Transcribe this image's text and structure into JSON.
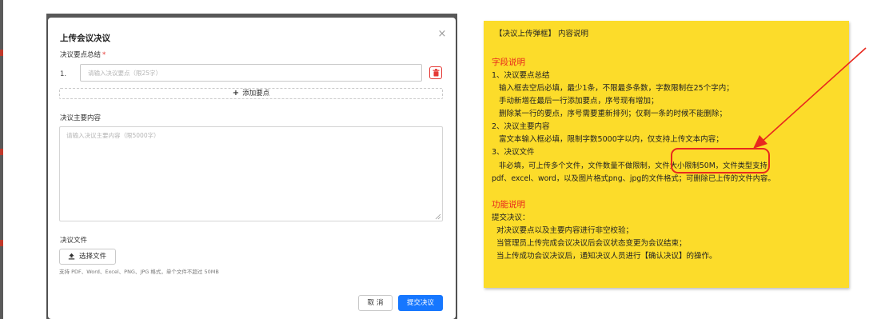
{
  "dialog": {
    "title": "上传会议决议",
    "close_symbol": "×",
    "points": {
      "label": "决议要点总结",
      "required_mark": "*",
      "items": [
        {
          "index": "1.",
          "value": "",
          "placeholder": "请输入决议要点（限25字）"
        }
      ],
      "add_label": "添加要点",
      "add_symbol": "+"
    },
    "content": {
      "label": "决议主要内容",
      "value": "",
      "placeholder": "请输入决议主要内容（限5000字）"
    },
    "files": {
      "label": "决议文件",
      "button_label": "选择文件",
      "hint": "支持 PDF、Word、Excel、PNG、JPG 格式，单个文件不超过 50MB"
    },
    "footer": {
      "cancel_label": "取 消",
      "submit_label": "提交决议"
    }
  },
  "note": {
    "heading": "【决议上传弹框】 内容说明",
    "fields_title": "字段说明",
    "fields": [
      "1、决议要点总结",
      "   输入框去空后必填，最少1条，不限最多条数，字数限制在25个字内；",
      "   手动新增在最后一行添加要点，序号现有增加；",
      "   删除某一行的要点，序号需要重新排列；仅剩一条的时候不能删除；",
      "2、决议主要内容",
      "   富文本输入框必填，限制字数5000字以内，仅支持上传文本内容；",
      "3、决议文件",
      "   非必填，可上传多个文件，文件数量不做限制，文件大小限制50M，文件类型支持",
      "pdf、excel、word，以及图片格式png、jpg的文件格式；可删除已上传的文件内容。"
    ],
    "functions_title": "功能说明",
    "functions": [
      "提交决议：",
      "  对决议要点以及主要内容进行非空校验；",
      "  当管理员上传完成会议决议后会议状态变更为会议结束；",
      "  当上传成功会议决议后，通知决议人员进行【确认决议】的操作。"
    ]
  },
  "colors": {
    "primary": "#1677ff",
    "danger": "#e53935",
    "note_background": "#fcdc2a",
    "annotation_red": "#e8281e"
  },
  "icons": [
    "close-icon",
    "trash-icon",
    "plus-icon",
    "upload-icon",
    "resize-grip-icon",
    "annotation-arrow"
  ]
}
